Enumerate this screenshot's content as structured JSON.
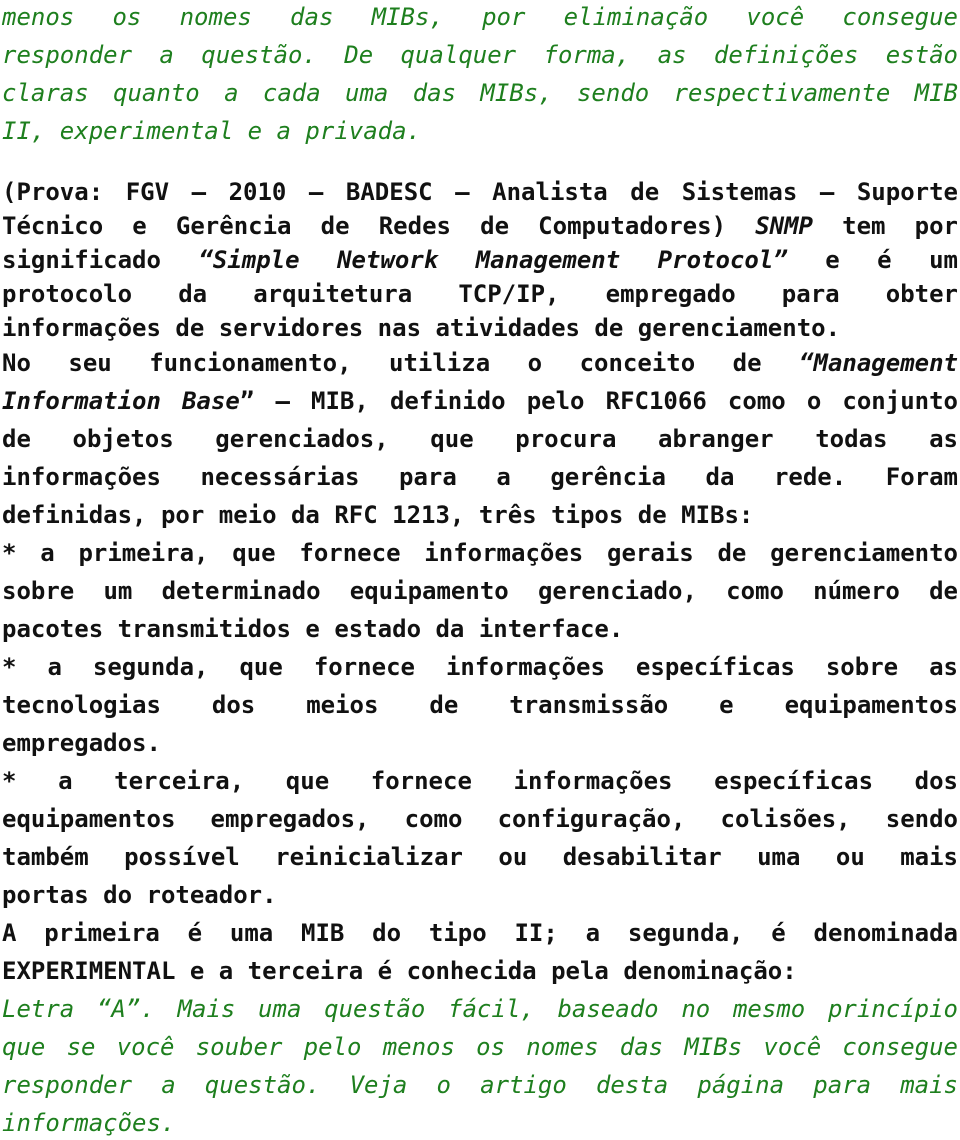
{
  "intro_answer": {
    "lines": [
      "menos os nomes das MIBs, por eliminação você consegue",
      "responder a questão. De qualquer forma, as definições estão",
      "claras quanto a cada uma das MIBs, sendo respectivamente MIB",
      "II, experimental e a privada."
    ]
  },
  "question": {
    "lines": [
      [
        "(Prova: FGV – 2010 – BADESC – Analista de Sistemas – Suporte"
      ],
      [
        "Técnico e Gerência de Redes de Computadores) ",
        "SNMP",
        " tem por"
      ],
      [
        "significado ",
        "“Simple Network Management Protocol”",
        " e é um"
      ],
      [
        "protocolo da arquitetura TCP/IP, empregado para obter"
      ],
      [
        "informações de servidores nas atividades de gerenciamento."
      ],
      [
        "No seu funcionamento, utiliza o conceito de ",
        "“Management"
      ],
      [
        "",
        "Information Base",
        "” – MIB, definido pelo RFC1066 como o conjunto"
      ],
      [
        "de objetos gerenciados, que procura abranger todas as"
      ],
      [
        "informações necessárias para a gerência da rede. Foram"
      ],
      [
        "definidas, por meio da RFC 1213, três tipos de MIBs:"
      ],
      [
        "* a primeira, que fornece informações gerais de gerenciamento"
      ],
      [
        "sobre um determinado equipamento gerenciado, como número de"
      ],
      [
        "pacotes transmitidos e estado da interface."
      ],
      [
        "* a segunda, que fornece informações específicas sobre as"
      ],
      [
        "tecnologias dos meios de transmissão e equipamentos"
      ],
      [
        "empregados."
      ],
      [
        "* a terceira, que fornece informações específicas dos"
      ],
      [
        "equipamentos empregados, como configuração, colisões, sendo"
      ],
      [
        "também possível reinicializar ou desabilitar uma ou mais"
      ],
      [
        "portas do roteador."
      ],
      [
        "A primeira é uma MIB do tipo II; a segunda, é denominada"
      ],
      [
        "EXPERIMENTAL e a terceira é conhecida pela denominação:"
      ]
    ]
  },
  "answer": {
    "lines": [
      "Letra “A”. Mais uma questão fácil, baseado no mesmo princípio",
      "que se você souber pelo menos os nomes das MIBs você consegue",
      "responder a questão. Veja o artigo desta página para mais",
      "informações."
    ]
  },
  "colors": {
    "answer_text": "#1e7f1e",
    "question_text": "#111111"
  }
}
